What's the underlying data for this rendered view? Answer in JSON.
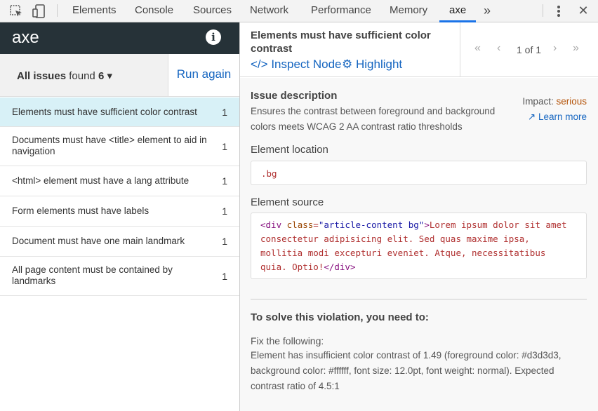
{
  "devtools": {
    "tabs": [
      "Elements",
      "Console",
      "Sources",
      "Network",
      "Performance",
      "Memory",
      "axe"
    ],
    "active_tab": "axe",
    "overflow_label": "»",
    "close_label": "✕",
    "accent": "#1a73e8"
  },
  "axe": {
    "title": "axe",
    "info_label": "i",
    "header_bg": "#263238"
  },
  "issues_filter": {
    "label": "All issues",
    "found_text": "found",
    "count": "6",
    "caret": "▾"
  },
  "run_again_label": "Run again",
  "issues": [
    {
      "label": "Elements must have sufficient color contrast",
      "count": "1"
    },
    {
      "label": "Documents must have <title> element to aid in navigation",
      "count": "1"
    },
    {
      "label": "<html> element must have a lang attribute",
      "count": "1"
    },
    {
      "label": "Form elements must have labels",
      "count": "1"
    },
    {
      "label": "Document must have one main landmark",
      "count": "1"
    },
    {
      "label": "All page content must be contained by landmarks",
      "count": "1"
    }
  ],
  "selected_issue": 0,
  "rule": {
    "title": "Elements must have sufficient color contrast",
    "inspect_label": "Inspect Node",
    "highlight_label": "Highlight",
    "pager_text": "1 of 1"
  },
  "details": {
    "issue_description_title": "Issue description",
    "issue_description": "Ensures the contrast between foreground and background colors meets WCAG 2 AA contrast ratio thresholds",
    "impact_label": "Impact:",
    "impact_value": "serious",
    "learn_more": "Learn more",
    "element_location_title": "Element location",
    "element_location": ".bg",
    "element_source_title": "Element source",
    "source": {
      "open_tag_start": "<div",
      "attr_name": "class",
      "attr_value": "\"article-content bg\"",
      "open_tag_end": ">",
      "text_line1": "Lorem ipsum dolor sit amet",
      "text_line2": "consectetur adipisicing elit. Sed quas maxime ipsa,",
      "text_line3": "mollitia modi excepturi eveniet. Atque, necessitatibus",
      "text_line4": "quia. Optio!",
      "close_tag": "</div>"
    },
    "solve_title": "To solve this violation, you need to:",
    "fix_label": "Fix the following:",
    "fix_text": "Element has insufficient color contrast of 1.49 (foreground color: #d3d3d3, background color: #ffffff, font size: 12.0pt, font weight: normal). Expected contrast ratio of 4.5:1",
    "impact_color": "#b45309"
  }
}
